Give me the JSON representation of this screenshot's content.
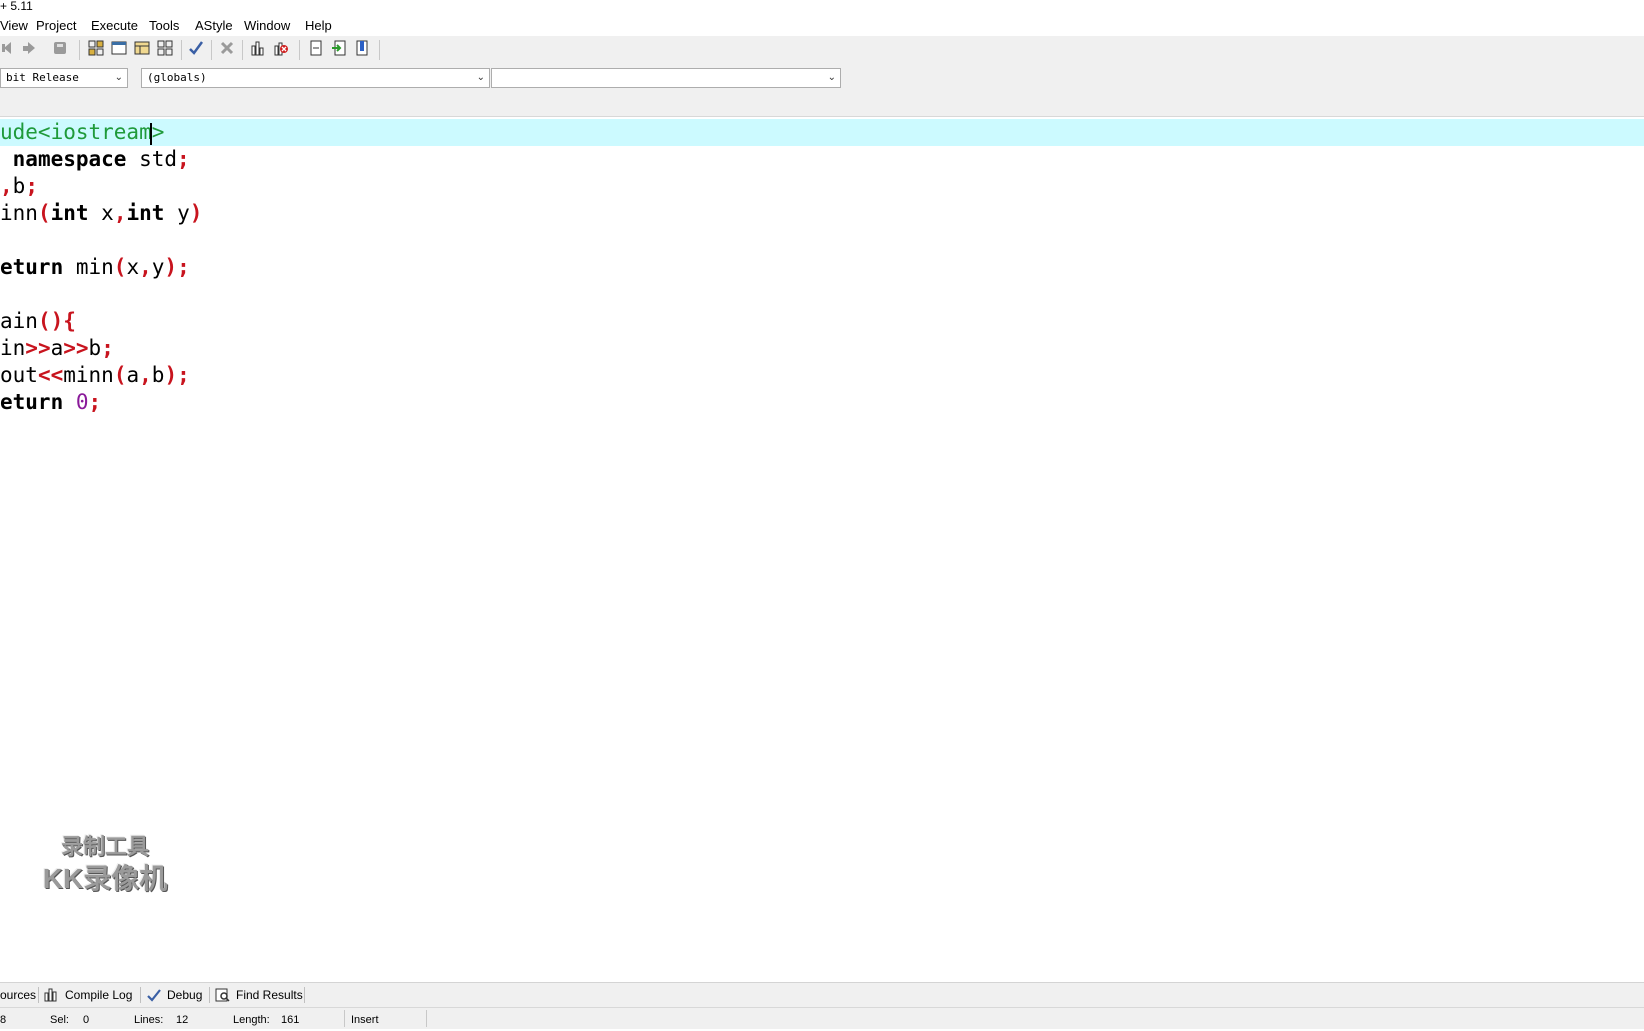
{
  "window": {
    "title_fragment": "+ 5.11"
  },
  "menu": {
    "items": [
      "View",
      "Project",
      "Execute",
      "Tools",
      "AStyle",
      "Window",
      "Help"
    ]
  },
  "toolbar": {
    "icons": [
      "undo-icon",
      "redo-icon",
      "save-icon",
      "grid-icon",
      "window-icon",
      "table-icon",
      "tiles-icon",
      "check-icon",
      "close-icon",
      "chart-icon",
      "profile-icon",
      "page-icon",
      "import-icon",
      "bookmark-icon"
    ]
  },
  "selectors": {
    "build_config": "bit Release",
    "scope": "(globals)",
    "member": ""
  },
  "editor": {
    "lines": [
      "ude<iostream>",
      " namespace std;",
      ",b;",
      "inn(int x,int y)",
      "",
      "eturn min(x,y);",
      "",
      "ain(){",
      "in>>a>>b;",
      "out<<minn(a,b);",
      "eturn 0;"
    ],
    "active_line": 0
  },
  "watermark": {
    "line1": "录制工具",
    "line2": "KK录像机"
  },
  "bottom_tabs": {
    "resources": "ources",
    "compile_log": "Compile Log",
    "debug": "Debug",
    "find_results": "Find Results"
  },
  "status": {
    "line_fragment": "8",
    "sel_label": "Sel:",
    "sel_value": "0",
    "lines_label": "Lines:",
    "lines_value": "12",
    "length_label": "Length:",
    "length_value": "161",
    "mode": "Insert"
  }
}
